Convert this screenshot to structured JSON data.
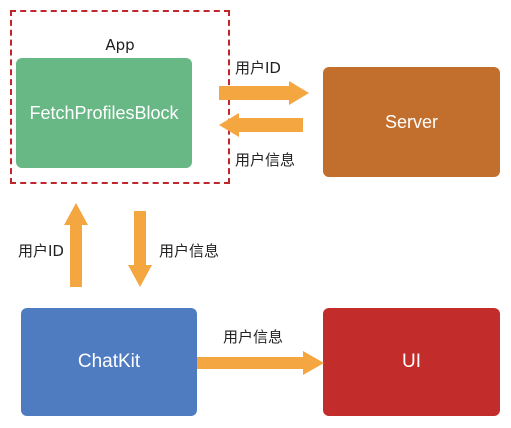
{
  "diagram": {
    "app_label": "App",
    "nodes": {
      "fetch_profiles_block": "FetchProfilesBlock",
      "server": "Server",
      "chatkit": "ChatKit",
      "ui": "UI"
    },
    "edge_labels": {
      "fetch_to_server": "用户ID",
      "server_to_fetch": "用户信息",
      "chatkit_to_fetch": "用户ID",
      "fetch_to_chatkit": "用户信息",
      "chatkit_to_ui": "用户信息"
    },
    "colors": {
      "fetch_profiles_block": "#68b885",
      "server": "#c26f2e",
      "chatkit": "#4f7cc1",
      "ui": "#c22c2b",
      "arrow": "#f4a640",
      "app_border": "#c0262b"
    }
  }
}
